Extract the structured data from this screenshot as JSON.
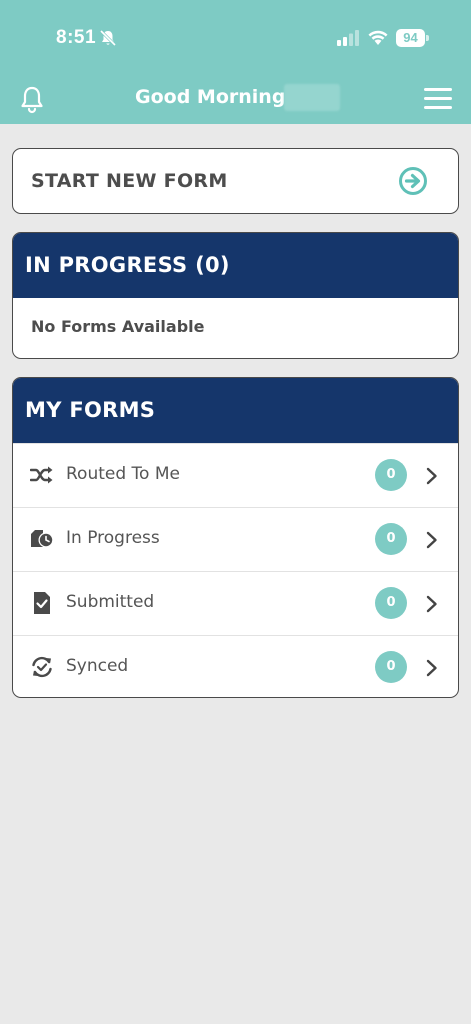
{
  "status_bar": {
    "time": "8:51",
    "battery": "94"
  },
  "header": {
    "greeting": "Good Morning,"
  },
  "start_form": {
    "label": "START NEW FORM"
  },
  "in_progress": {
    "title": "IN PROGRESS (0)",
    "empty_message": "No Forms Available"
  },
  "my_forms": {
    "title": "MY FORMS",
    "items": [
      {
        "label": "Routed To Me",
        "count": "0",
        "icon": "shuffle-icon"
      },
      {
        "label": "In Progress",
        "count": "0",
        "icon": "clock-folder-icon"
      },
      {
        "label": "Submitted",
        "count": "0",
        "icon": "doc-check-icon"
      },
      {
        "label": "Synced",
        "count": "0",
        "icon": "sync-check-icon"
      }
    ]
  },
  "colors": {
    "header_teal": "#7ecbc4",
    "navy": "#15366b",
    "background": "#e9e9e9"
  }
}
